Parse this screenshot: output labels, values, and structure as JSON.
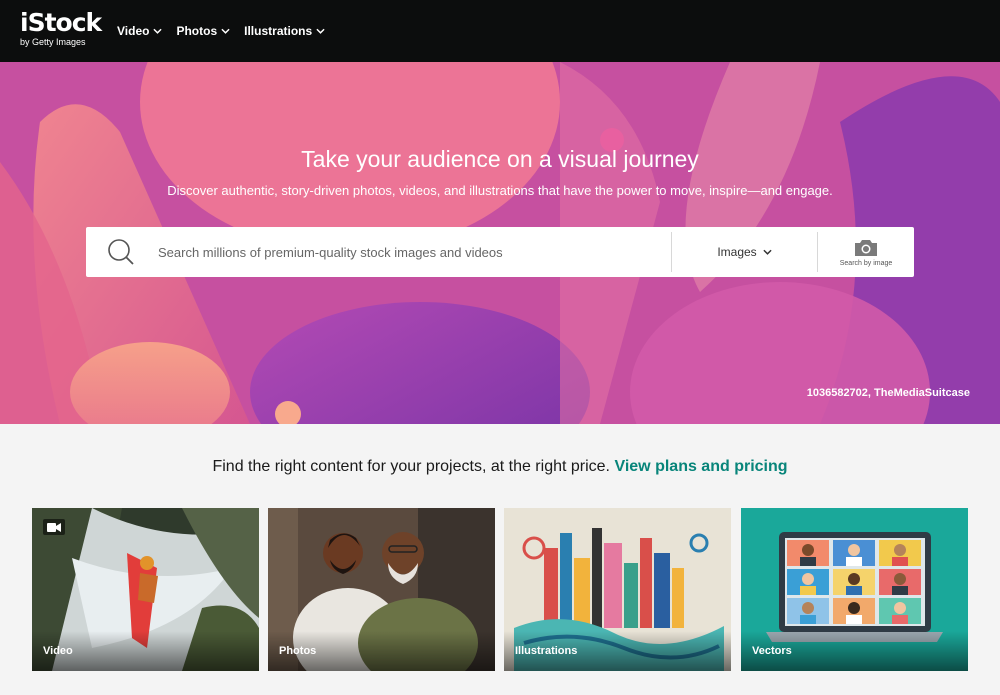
{
  "brand": {
    "logo_text": "iStock",
    "logo_sub": "by Getty Images"
  },
  "nav": {
    "items": [
      {
        "label": "Video"
      },
      {
        "label": "Photos"
      },
      {
        "label": "Illustrations"
      }
    ]
  },
  "hero": {
    "title": "Take your audience on a visual journey",
    "subtitle": "Discover authentic, story-driven photos, videos, and illustrations that have the power to move, inspire—and engage.",
    "search": {
      "placeholder": "Search millions of premium-quality stock images and videos",
      "value": "",
      "type_selected": "Images",
      "search_by_image_label": "Search by image"
    },
    "credit": "1036582702, TheMediaSuitcase"
  },
  "promo": {
    "text": "Find the right content for your projects, at the right price.",
    "link": "View plans and pricing"
  },
  "cards": [
    {
      "label": "Video"
    },
    {
      "label": "Photos"
    },
    {
      "label": "Illustrations"
    },
    {
      "label": "Vectors"
    }
  ],
  "colors": {
    "nav_bg": "#0c0d0d",
    "link_green": "#08857a",
    "hero_pink": "#e35c8a",
    "hero_purple": "#7a35ab",
    "vectors_teal": "#1aa89a"
  },
  "icons": {
    "search": "search-icon",
    "camera": "camera-icon",
    "chevron": "chevron-down-icon",
    "video": "video-camera-icon"
  }
}
